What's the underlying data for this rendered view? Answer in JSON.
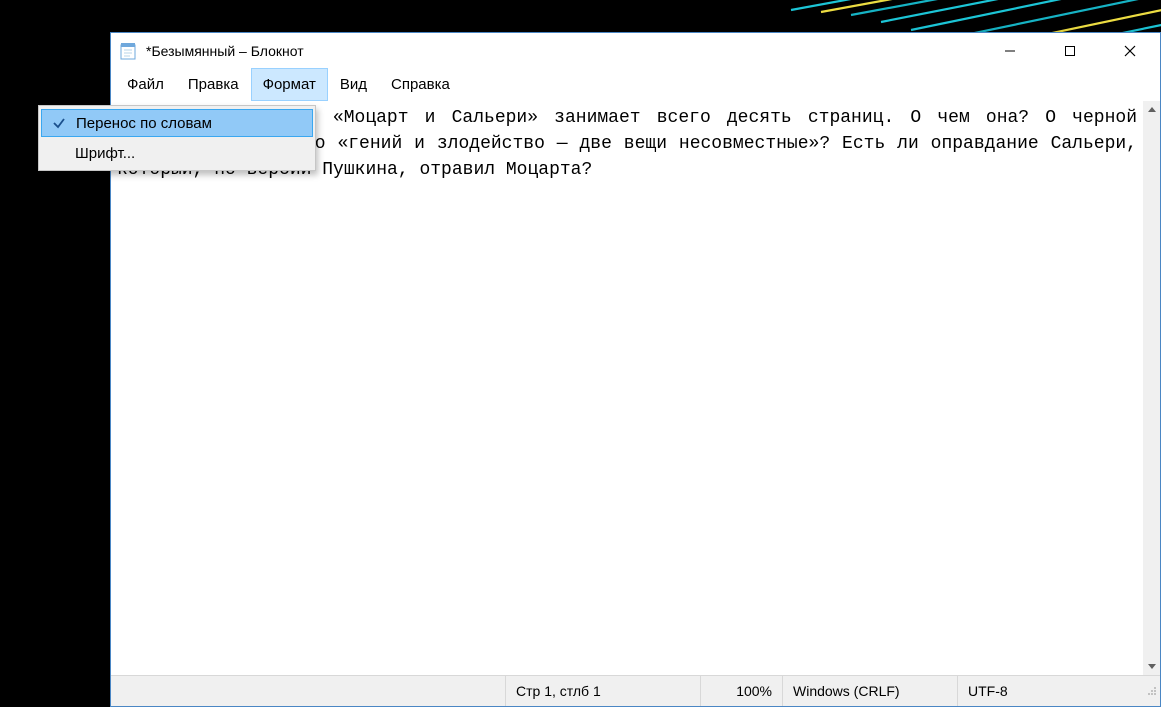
{
  "window": {
    "title": "*Безымянный – Блокнот"
  },
  "menu": {
    "items": [
      "Файл",
      "Правка",
      "Формат",
      "Вид",
      "Справка"
    ],
    "active_index": 2
  },
  "dropdown": {
    "items": [
      {
        "label": "Перенос по словам",
        "checked": true,
        "hovered": true
      },
      {
        "label": "Шрифт...",
        "checked": false,
        "hovered": false
      }
    ]
  },
  "editor": {
    "content": "Маленькая трагедия «Моцарт и Сальери» занимает всего десять страниц. О чем она? О черной зависти? О том, что «гений и злодейство — две вещи несовместные»? Есть ли оправдание Сальери, который, по версии Пушкина, отравил Моцарта?"
  },
  "statusbar": {
    "position": "Стр 1, стлб 1",
    "zoom": "100%",
    "line_ending": "Windows (CRLF)",
    "encoding": "UTF-8"
  }
}
